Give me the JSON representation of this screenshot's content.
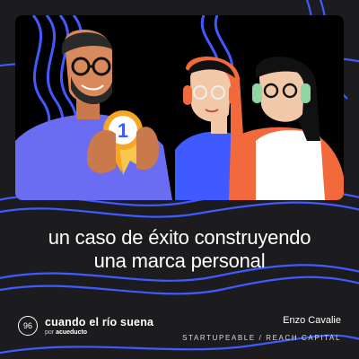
{
  "episode": {
    "number": "96"
  },
  "title": {
    "line1": "un caso de éxito construyendo",
    "line2": "una marca personal"
  },
  "show": {
    "name": "cuando el río suena",
    "by_prefix": "por",
    "by_brand": "acueducto"
  },
  "guest": {
    "name": "Enzo Cavalie",
    "company": "STARTUPEABLE / REACH CAPITAL"
  },
  "medal": {
    "label": "1"
  },
  "colors": {
    "background": "#1c1c1f",
    "accent_blue": "#3f5bff",
    "illustration_bg": "#000000",
    "orange": "#f26a3c"
  },
  "icons": [
    "waves-decoration",
    "medal-icon",
    "headphones-icon",
    "glasses-icon"
  ]
}
